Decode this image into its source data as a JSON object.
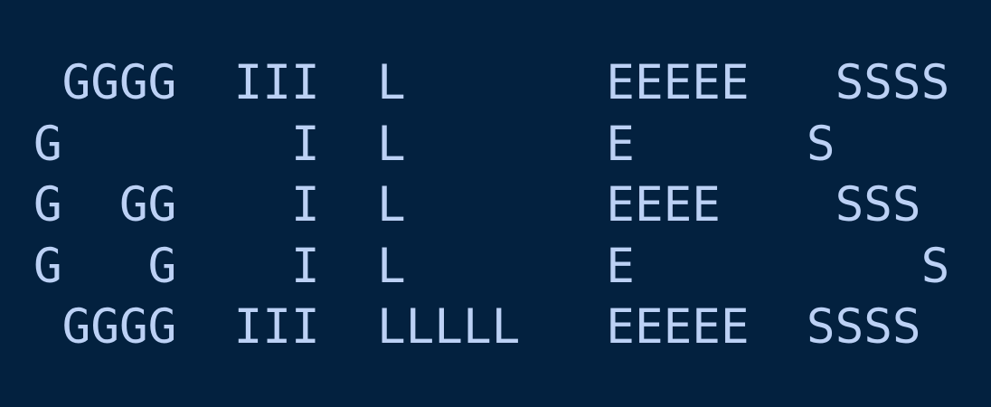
{
  "terminal": {
    "background_color": "#03213f",
    "text_color": "#bcd1f5",
    "lines": [
      " GGGG  III  L       EEEEE   SSSS",
      "G        I  L       E      S",
      "G  GG    I  L       EEEE    SSS",
      "G   G    I  L       E          S",
      " GGGG  III  LLLLL   EEEEE  SSSS"
    ]
  }
}
